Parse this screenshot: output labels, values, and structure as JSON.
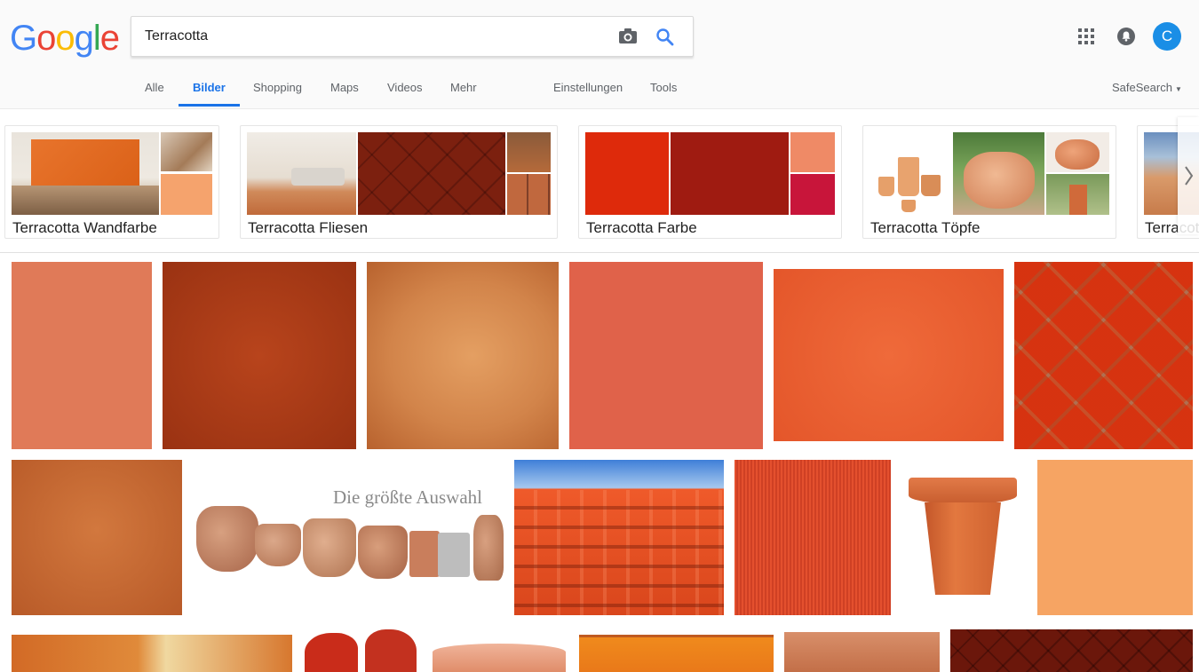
{
  "header": {
    "logo": [
      "G",
      "o",
      "o",
      "g",
      "l",
      "e"
    ],
    "search": {
      "value": "Terracotta",
      "placeholder": ""
    },
    "account_initial": "C"
  },
  "tabs": [
    {
      "label": "Alle"
    },
    {
      "label": "Bilder"
    },
    {
      "label": "Shopping"
    },
    {
      "label": "Maps"
    },
    {
      "label": "Videos"
    },
    {
      "label": "Mehr"
    }
  ],
  "tools": {
    "settings": "Einstellungen",
    "tools": "Tools",
    "safesearch": "SafeSearch"
  },
  "related": [
    {
      "label": "Terracotta Wandfarbe"
    },
    {
      "label": "Terracotta Fliesen"
    },
    {
      "label": "Terracotta Farbe"
    },
    {
      "label": "Terracotta Töpfe"
    },
    {
      "label": "Terracot"
    }
  ],
  "results": {
    "banner_text": "Die größte Auswahl"
  },
  "colors": {
    "accent": "#1a73e8",
    "avatar": "#1a8ee6",
    "google_blue": "#4285f4",
    "google_red": "#ea4335",
    "google_yellow": "#fbbc05",
    "google_green": "#34a853"
  }
}
